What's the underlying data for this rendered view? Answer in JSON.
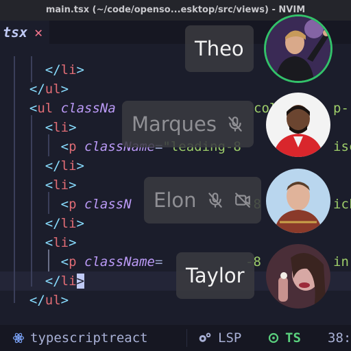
{
  "window": {
    "title": "main.tsx (~/code/openso...esktop/src/views) - NVIM"
  },
  "tab": {
    "name": "tsx",
    "close": "✕"
  },
  "code": {
    "lines": [
      {
        "indent": "    ",
        "parts": [
          [
            "br",
            "</"
          ],
          [
            "tag",
            "li"
          ],
          [
            "br",
            ">"
          ]
        ]
      },
      {
        "indent": "  ",
        "parts": [
          [
            "br",
            "</"
          ],
          [
            "tag",
            "ul"
          ],
          [
            "br",
            ">"
          ]
        ]
      },
      {
        "indent": "  ",
        "parts": [
          [
            "br",
            "<"
          ],
          [
            "tag",
            "ul"
          ],
          [
            "sp",
            " "
          ],
          [
            "attr",
            "classNa"
          ]
        ]
      },
      {
        "indent": "    ",
        "parts": [
          [
            "br",
            "<"
          ],
          [
            "tag",
            "li"
          ],
          [
            "br",
            ">"
          ]
        ]
      },
      {
        "indent": "      ",
        "parts": [
          [
            "br",
            "<"
          ],
          [
            "tag",
            "p"
          ],
          [
            "sp",
            " "
          ],
          [
            "attr",
            "className"
          ],
          [
            "bk",
            "="
          ],
          [
            "str",
            "\"leading-8"
          ]
        ]
      },
      {
        "indent": "    ",
        "parts": [
          [
            "br",
            "</"
          ],
          [
            "tag",
            "li"
          ],
          [
            "br",
            ">"
          ]
        ]
      },
      {
        "indent": "    ",
        "parts": [
          [
            "br",
            "<"
          ],
          [
            "tag",
            "li"
          ],
          [
            "br",
            ">"
          ]
        ]
      },
      {
        "indent": "      ",
        "parts": [
          [
            "br",
            "<"
          ],
          [
            "tag",
            "p"
          ],
          [
            "sp",
            " "
          ],
          [
            "attr",
            "classN"
          ]
        ]
      },
      {
        "indent": "    ",
        "parts": [
          [
            "br",
            "</"
          ],
          [
            "tag",
            "li"
          ],
          [
            "br",
            ">"
          ]
        ]
      },
      {
        "indent": "    ",
        "parts": [
          [
            "br",
            "<"
          ],
          [
            "tag",
            "li"
          ],
          [
            "br",
            ">"
          ]
        ]
      },
      {
        "indent": "      ",
        "parts": [
          [
            "br",
            "<"
          ],
          [
            "tag",
            "p"
          ],
          [
            "sp",
            " "
          ],
          [
            "attr",
            "className"
          ],
          [
            "bk",
            "="
          ]
        ]
      },
      {
        "indent": "    ",
        "parts": [
          [
            "br",
            "</"
          ],
          [
            "tag",
            "li"
          ],
          [
            "cur",
            ">"
          ]
        ]
      },
      {
        "indent": "  ",
        "parts": [
          [
            "br",
            "</"
          ],
          [
            "tag",
            "ul"
          ],
          [
            "br",
            ">"
          ]
        ]
      }
    ],
    "fragments": [
      {
        "text": "col",
        "color": "#9ece6a"
      },
      {
        "text": "p-",
        "color": "#9ece6a"
      },
      {
        "text": "iscu",
        "color": "#9ece6a"
      },
      {
        "text": "-8",
        "color": "#9ece6a"
      },
      {
        "text": "ick",
        "color": "#9ece6a"
      },
      {
        "text": "-8",
        "color": "#9ece6a"
      },
      {
        "text": "in",
        "color": "#9ece6a"
      }
    ]
  },
  "participants": [
    {
      "name": "Theo",
      "muted": false,
      "camera_off": false,
      "speaking": true
    },
    {
      "name": "Marques",
      "muted": true,
      "camera_off": false,
      "speaking": false
    },
    {
      "name": "Elon",
      "muted": true,
      "camera_off": true,
      "speaking": false
    },
    {
      "name": "Taylor",
      "muted": false,
      "camera_off": false,
      "speaking": false
    }
  ],
  "status": {
    "filetype": "typescriptreact",
    "lsp": "LSP",
    "ts": "TS",
    "position": "38:"
  },
  "colors": {
    "accent_green": "#33c26a",
    "tag": "#e06c75",
    "attr": "#bb9af7",
    "string": "#9ece6a"
  }
}
